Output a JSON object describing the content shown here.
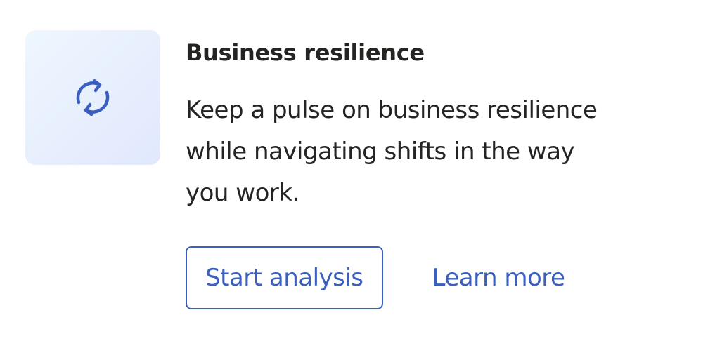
{
  "card": {
    "icon": "sync-icon",
    "title": "Business resilience",
    "description": "Keep a pulse on business resilience\nwhile navigating shifts in the way\nyou work.",
    "primary_button_label": "Start analysis",
    "link_label": "Learn more"
  },
  "colors": {
    "accent": "#3b5fc0",
    "text": "#252423",
    "icon_tile_start": "#eef7fe",
    "icon_tile_end": "#e1e8fd"
  }
}
